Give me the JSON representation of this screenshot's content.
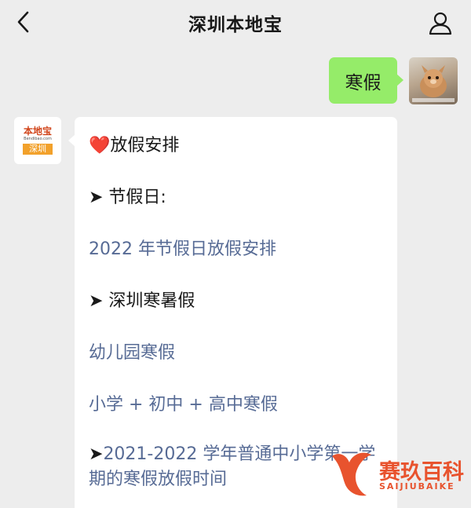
{
  "header": {
    "title": "深圳本地宝"
  },
  "outgoing": {
    "text": "寒假"
  },
  "bot": {
    "brand": "本地宝",
    "domain": "Bendibao.com",
    "city": "深圳"
  },
  "message": {
    "heading_icon": "❤️",
    "heading": "放假安排",
    "section1_arrow": "➤",
    "section1": " 节假日:",
    "link1": "2022 年节假日放假安排",
    "section2_arrow": "➤",
    "section2": " 深圳寒暑假",
    "link2": "幼儿园寒假",
    "link3": "小学 + 初中 + 高中寒假",
    "section3_arrow": "➤",
    "link4": "2021-2022 学年普通中小学第一学期的寒假放假时间"
  },
  "watermark": {
    "name": "赛玖百科",
    "sub": "SAIJIUBAIKE"
  },
  "colors": {
    "background": "#ededed",
    "outgoing_bubble": "#95ec69",
    "link": "#576b95",
    "watermark": "#e8532e"
  }
}
